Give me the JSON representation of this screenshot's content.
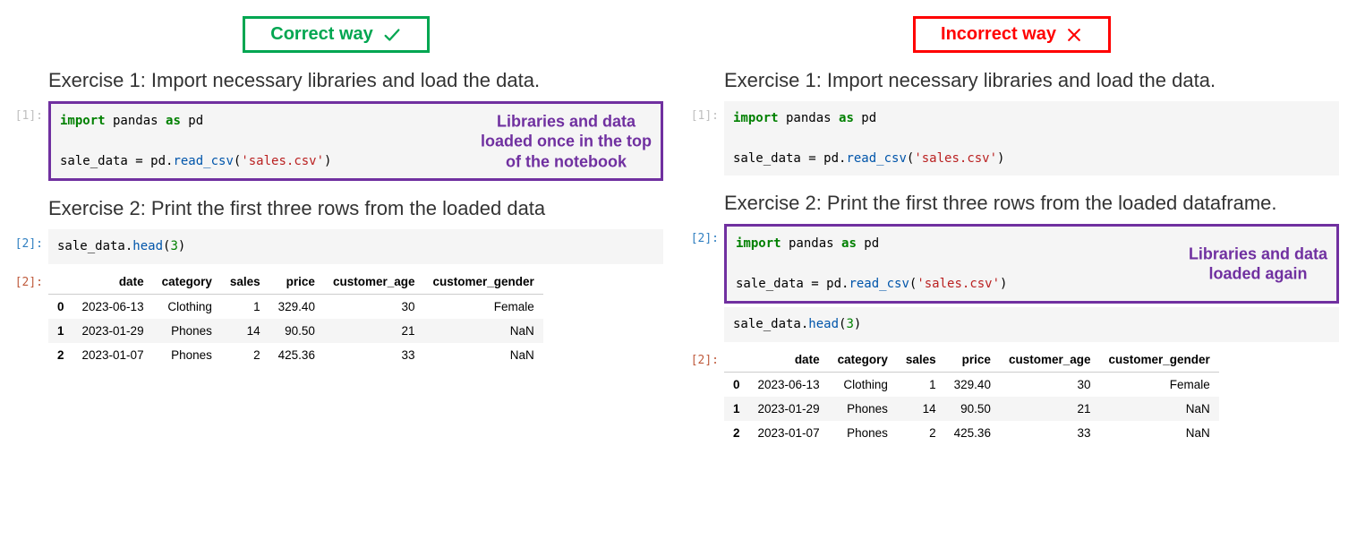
{
  "left": {
    "title": "Correct way",
    "heading1": "Exercise 1: Import necessary libraries and load the data.",
    "heading2": "Exercise 2: Print the first three rows from the loaded data",
    "prompt1": "[1]:",
    "prompt2": "[2]:",
    "prompt3": "[2]:",
    "annot1": "Libraries and data loaded once in the top of the notebook",
    "code1_kw_import": "import",
    "code1_pandas": " pandas ",
    "code1_kw_as": "as",
    "code1_pd": " pd",
    "code1_line2a": "sale_data = pd.",
    "code1_fn": "read_csv",
    "code1_paren_open": "(",
    "code1_str": "'sales.csv'",
    "code1_paren_close": ")",
    "code2a": "sale_data.",
    "code2_fn": "head",
    "code2_open": "(",
    "code2_num": "3",
    "code2_close": ")"
  },
  "right": {
    "title": "Incorrect way",
    "heading1": "Exercise 1: Import necessary libraries and load the data.",
    "heading2": "Exercise 2: Print the first three rows from the loaded dataframe.",
    "prompt1": "[1]:",
    "prompt2": "[2]:",
    "prompt3": "[2]:",
    "annot2": "Libraries and data loaded again",
    "code1_kw_import": "import",
    "code1_pandas": " pandas ",
    "code1_kw_as": "as",
    "code1_pd": " pd",
    "code1_line2a": "sale_data = pd.",
    "code1_fn": "read_csv",
    "code1_paren_open": "(",
    "code1_str": "'sales.csv'",
    "code1_paren_close": ")",
    "code3a": "sale_data.",
    "code3_fn": "head",
    "code3_open": "(",
    "code3_num": "3",
    "code3_close": ")"
  },
  "table": {
    "columns": [
      "date",
      "category",
      "sales",
      "price",
      "customer_age",
      "customer_gender"
    ],
    "rows": [
      {
        "idx": "0",
        "date": "2023-06-13",
        "category": "Clothing",
        "sales": "1",
        "price": "329.40",
        "customer_age": "30",
        "customer_gender": "Female"
      },
      {
        "idx": "1",
        "date": "2023-01-29",
        "category": "Phones",
        "sales": "14",
        "price": "90.50",
        "customer_age": "21",
        "customer_gender": "NaN"
      },
      {
        "idx": "2",
        "date": "2023-01-07",
        "category": "Phones",
        "sales": "2",
        "price": "425.36",
        "customer_age": "33",
        "customer_gender": "NaN"
      }
    ]
  }
}
